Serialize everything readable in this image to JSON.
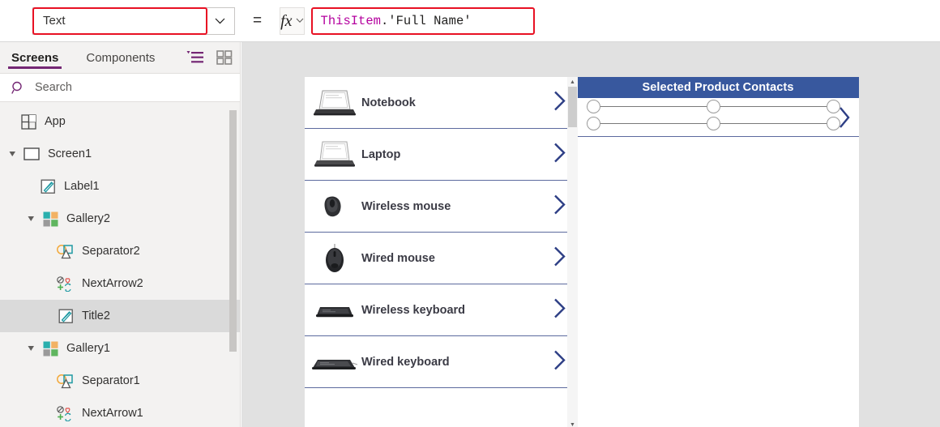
{
  "formula_bar": {
    "property_value": "Text",
    "property_caret_icon": "chevron-down-icon",
    "equals": "=",
    "fx_label": "fx",
    "fx_caret_icon": "chevron-down-icon",
    "formula_token_identifier": "ThisItem",
    "formula_token_rest": ".'Full Name'",
    "formula_full": "ThisItem.'Full Name'",
    "annotation_color": "#e81123"
  },
  "sidebar": {
    "tabs": [
      {
        "label": "Screens",
        "active": true
      },
      {
        "label": "Components",
        "active": false
      }
    ],
    "view_buttons": [
      {
        "name": "tree-view-icon",
        "active": true
      },
      {
        "name": "thumbnail-view-icon",
        "active": false
      }
    ],
    "search": {
      "placeholder": "Search",
      "value": "",
      "icon": "search-icon"
    },
    "accent_color": "#742774",
    "tree": [
      {
        "label": "App",
        "indent": 0,
        "twisty": "none",
        "icon": "app-icon",
        "selected": false
      },
      {
        "label": "Screen1",
        "indent": 0,
        "twisty": "expanded",
        "icon": "screen-icon",
        "selected": false
      },
      {
        "label": "Label1",
        "indent": 1,
        "twisty": "none",
        "icon": "label-icon",
        "selected": false
      },
      {
        "label": "Gallery2",
        "indent": 1,
        "twisty": "expanded",
        "icon": "gallery-icon",
        "selected": false
      },
      {
        "label": "Separator2",
        "indent": 2,
        "twisty": "none",
        "icon": "shape-icon",
        "selected": false
      },
      {
        "label": "NextArrow2",
        "indent": 2,
        "twisty": "none",
        "icon": "icon-icon",
        "selected": false
      },
      {
        "label": "Title2",
        "indent": 2,
        "twisty": "none",
        "icon": "label-icon",
        "selected": true
      },
      {
        "label": "Gallery1",
        "indent": 1,
        "twisty": "expanded",
        "icon": "gallery-icon",
        "selected": false
      },
      {
        "label": "Separator1",
        "indent": 2,
        "twisty": "none",
        "icon": "shape-icon",
        "selected": false
      },
      {
        "label": "NextArrow1",
        "indent": 2,
        "twisty": "none",
        "icon": "icon-icon",
        "selected": false
      }
    ]
  },
  "canvas": {
    "product_gallery": {
      "items": [
        {
          "name": "Notebook",
          "thumb": "laptop-photo"
        },
        {
          "name": "Laptop",
          "thumb": "laptop-photo"
        },
        {
          "name": "Wireless mouse",
          "thumb": "mouse-photo"
        },
        {
          "name": "Wired mouse",
          "thumb": "mouse-photo"
        },
        {
          "name": "Wireless keyboard",
          "thumb": "keyboard-photo"
        },
        {
          "name": "Wired keyboard",
          "thumb": "keyboard-photo"
        }
      ],
      "chevron_icon": "chevron-right-icon",
      "separator_color": "#5c6a9e"
    },
    "contacts_gallery": {
      "header_title": "Selected Product Contacts",
      "header_color": "#38589e",
      "chevron_icon": "chevron-right-icon",
      "selected": true
    }
  }
}
